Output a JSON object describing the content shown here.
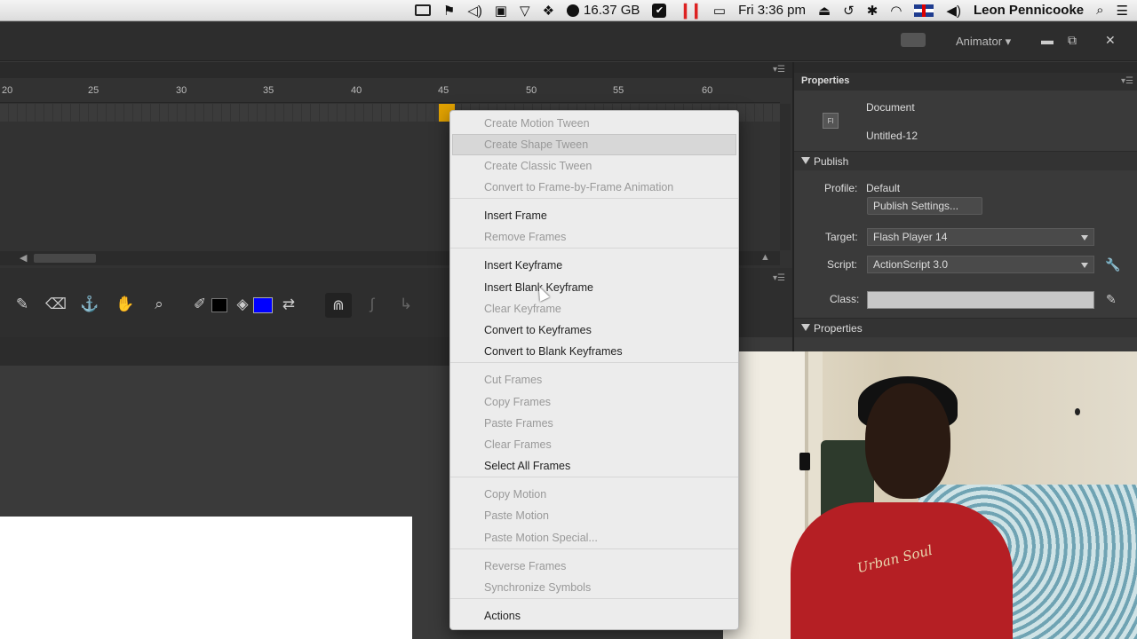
{
  "menubar": {
    "storage": "16.37 GB",
    "clock": "Fri 3:36 pm",
    "user": "Leon Pennicooke"
  },
  "app": {
    "workspace": "Animator"
  },
  "timeline": {
    "ruler_ticks": [
      "20",
      "25",
      "30",
      "35",
      "40",
      "45",
      "50",
      "55",
      "60"
    ]
  },
  "context_menu": {
    "items": [
      {
        "label": "Create Motion Tween",
        "enabled": false
      },
      {
        "label": "Create Shape Tween",
        "enabled": false
      },
      {
        "label": "Create Classic Tween",
        "enabled": false
      },
      {
        "label": "Convert to Frame-by-Frame Animation",
        "enabled": false
      },
      {
        "label": "Insert Frame",
        "enabled": true
      },
      {
        "label": "Remove Frames",
        "enabled": false
      },
      {
        "label": "Insert Keyframe",
        "enabled": true
      },
      {
        "label": "Insert Blank Keyframe",
        "enabled": true
      },
      {
        "label": "Clear Keyframe",
        "enabled": false
      },
      {
        "label": "Convert to Keyframes",
        "enabled": true
      },
      {
        "label": "Convert to Blank Keyframes",
        "enabled": true
      },
      {
        "label": "Cut Frames",
        "enabled": false
      },
      {
        "label": "Copy Frames",
        "enabled": false
      },
      {
        "label": "Paste Frames",
        "enabled": false
      },
      {
        "label": "Clear Frames",
        "enabled": false
      },
      {
        "label": "Select All Frames",
        "enabled": true
      },
      {
        "label": "Copy Motion",
        "enabled": false
      },
      {
        "label": "Paste Motion",
        "enabled": false
      },
      {
        "label": "Paste Motion Special...",
        "enabled": false
      },
      {
        "label": "Reverse Frames",
        "enabled": false
      },
      {
        "label": "Synchronize Symbols",
        "enabled": false
      },
      {
        "label": "Actions",
        "enabled": true
      }
    ]
  },
  "properties": {
    "tab": "Properties",
    "doc_type": "Document",
    "doc_name": "Untitled-12",
    "doc_icon": "Fl",
    "publish_header": "Publish",
    "profile_label": "Profile:",
    "profile_value": "Default",
    "publish_settings": "Publish Settings...",
    "target_label": "Target:",
    "target_value": "Flash Player 14",
    "script_label": "Script:",
    "script_value": "ActionScript 3.0",
    "class_label": "Class:",
    "properties_header": "Properties"
  },
  "webcam": {
    "shirt_text": "Urban Soul"
  }
}
